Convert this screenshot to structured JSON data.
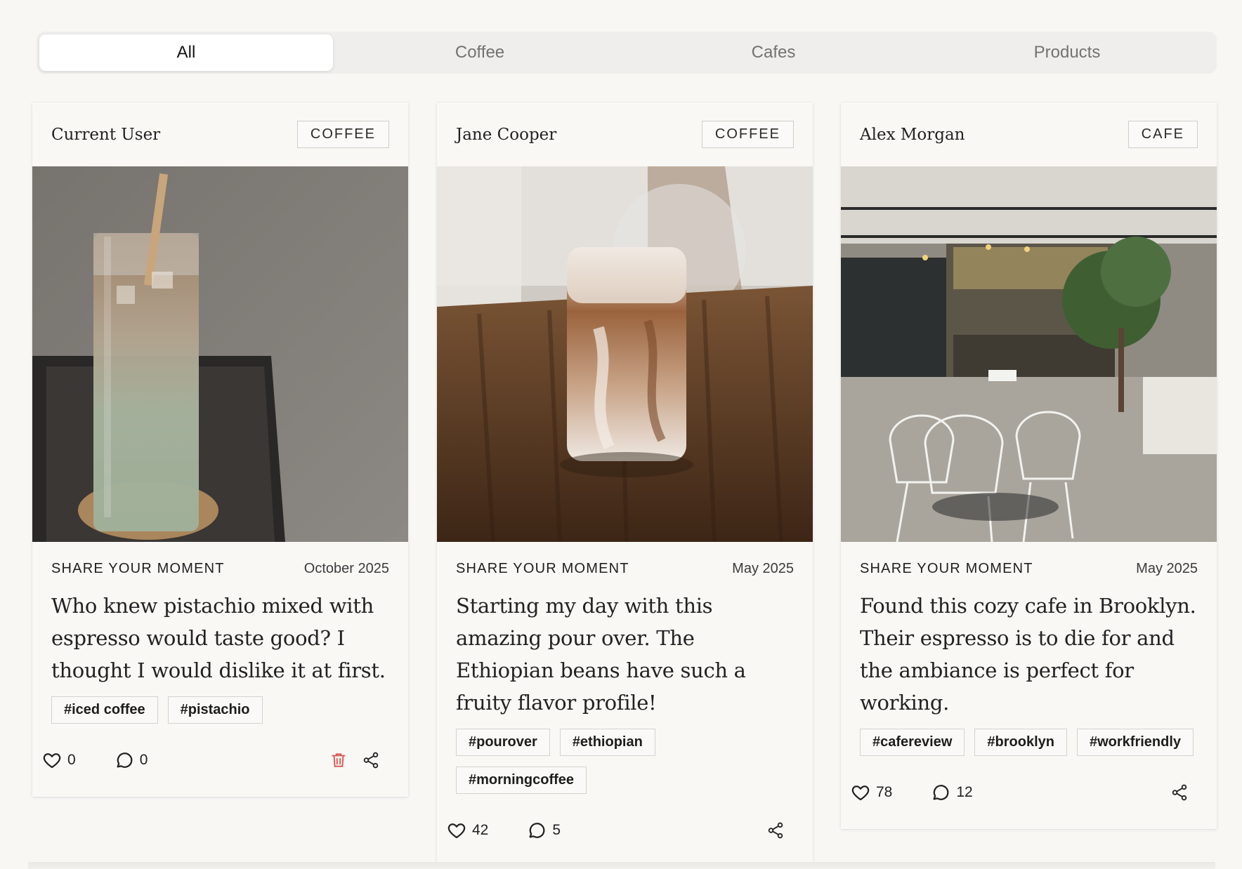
{
  "tabs": [
    {
      "label": "All",
      "active": true
    },
    {
      "label": "Coffee",
      "active": false
    },
    {
      "label": "Cafes",
      "active": false
    },
    {
      "label": "Products",
      "active": false
    }
  ],
  "posts": [
    {
      "author": "Current User",
      "category": "COFFEE",
      "image": "iced pistachio latte in tall glass",
      "label": "SHARE YOUR MOMENT",
      "date": "October 2025",
      "caption": "Who knew pistachio mixed with espresso would taste good? I thought I would dislike it at first.",
      "tags": [
        "#iced coffee",
        "#pistachio"
      ],
      "likes": "0",
      "comments": "0",
      "deletable": true
    },
    {
      "author": "Jane Cooper",
      "category": "COFFEE",
      "image": "iced coffee with milk on wooden table",
      "label": "SHARE YOUR MOMENT",
      "date": "May 2025",
      "caption": "Starting my day with this amazing pour over. The Ethiopian beans have such a fruity flavor profile!",
      "tags": [
        "#pourover",
        "#ethiopian",
        "#morningcoffee"
      ],
      "likes": "42",
      "comments": "5",
      "deletable": false
    },
    {
      "author": "Alex Morgan",
      "category": "CAFE",
      "image": "cafe interior with chairs and plants",
      "label": "SHARE YOUR MOMENT",
      "date": "May 2025",
      "caption": "Found this cozy cafe in Brooklyn. Their espresso is to die for and the ambiance is perfect for working.",
      "tags": [
        "#cafereview",
        "#brooklyn",
        "#workfriendly"
      ],
      "likes": "78",
      "comments": "12",
      "deletable": false
    }
  ],
  "icons": {
    "like": "heart-icon",
    "comment": "comment-icon",
    "delete": "trash-icon",
    "share": "share-icon"
  },
  "colors": {
    "background": "#f8f7f4",
    "delete": "#d9534f"
  }
}
